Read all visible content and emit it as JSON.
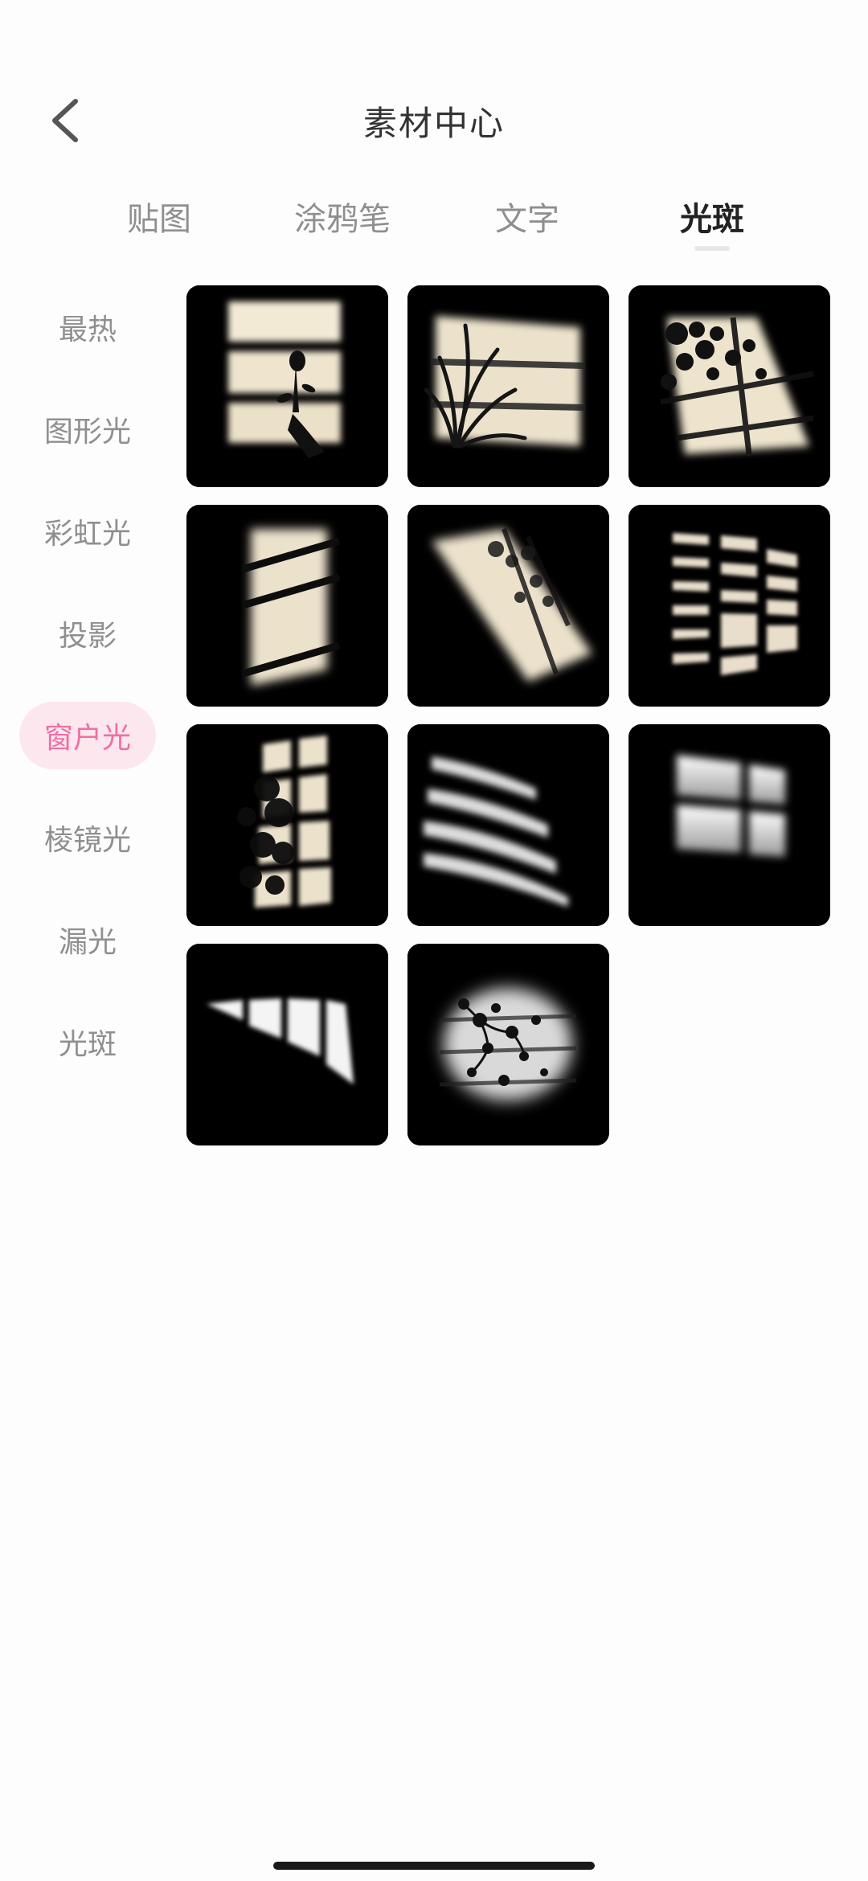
{
  "header": {
    "title": "素材中心",
    "back_icon": "chevron-left-icon"
  },
  "tabs": [
    {
      "label": "贴图",
      "active": false
    },
    {
      "label": "涂鸦笔",
      "active": false
    },
    {
      "label": "文字",
      "active": false
    },
    {
      "label": "光斑",
      "active": true
    }
  ],
  "sidebar": {
    "items": [
      {
        "label": "最热",
        "active": false
      },
      {
        "label": "图形光",
        "active": false
      },
      {
        "label": "彩虹光",
        "active": false
      },
      {
        "label": "投影",
        "active": false
      },
      {
        "label": "窗户光",
        "active": true
      },
      {
        "label": "棱镜光",
        "active": false
      },
      {
        "label": "漏光",
        "active": false
      },
      {
        "label": "光斑",
        "active": false
      }
    ]
  },
  "colors": {
    "accent_pink": "#ee6fa3",
    "accent_pink_bg": "#fde7ef",
    "tile_bg": "#000000",
    "warm_light": "#f3ead6"
  },
  "grid": {
    "items": [
      {
        "name": "window-rose-shadow"
      },
      {
        "name": "window-plant-shadow"
      },
      {
        "name": "window-leaves-diagonal"
      },
      {
        "name": "window-slats-vertical"
      },
      {
        "name": "window-leaves-slanted"
      },
      {
        "name": "window-blinds-shadow"
      },
      {
        "name": "window-grid-tree-shadow"
      },
      {
        "name": "window-slats-curved"
      },
      {
        "name": "window-panes-bright"
      },
      {
        "name": "window-bars-diagonal"
      },
      {
        "name": "window-flowers-shadow"
      }
    ]
  }
}
